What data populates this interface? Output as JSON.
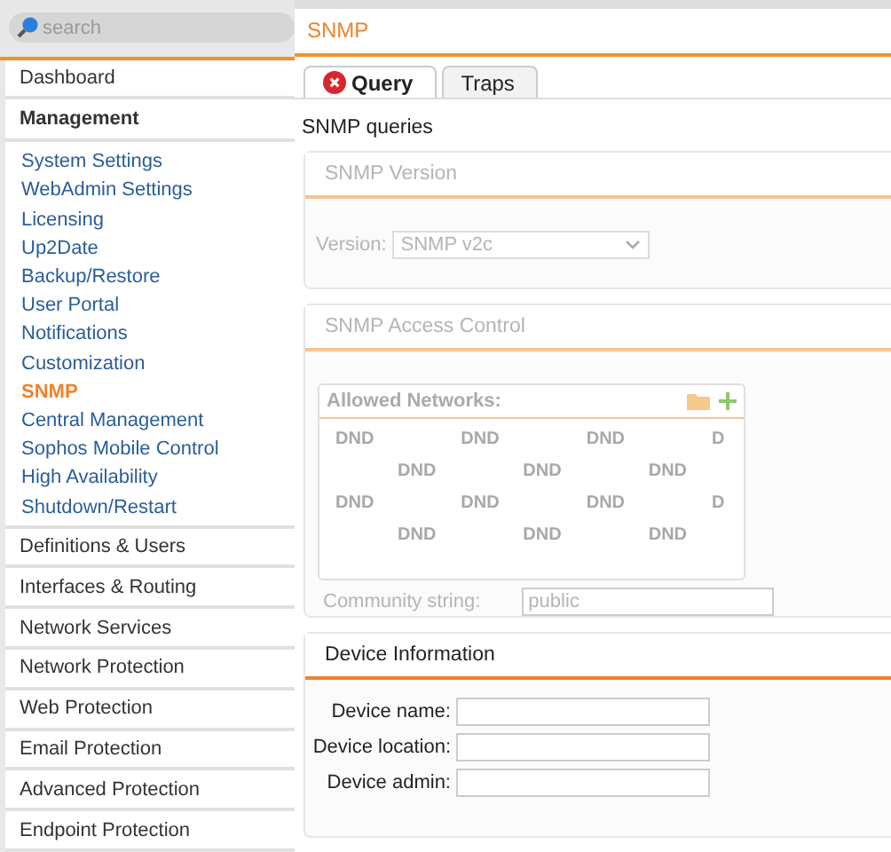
{
  "search": {
    "placeholder": "search"
  },
  "sidebar": {
    "items": [
      {
        "label": "Dashboard",
        "expanded": false
      },
      {
        "label": "Management",
        "expanded": true,
        "children": [
          {
            "label": "System Settings",
            "selected": false
          },
          {
            "label": "WebAdmin Settings",
            "selected": false
          },
          {
            "label": "Licensing",
            "selected": false
          },
          {
            "label": "Up2Date",
            "selected": false
          },
          {
            "label": "Backup/Restore",
            "selected": false
          },
          {
            "label": "User Portal",
            "selected": false
          },
          {
            "label": "Notifications",
            "selected": false
          },
          {
            "label": "Customization",
            "selected": false
          },
          {
            "label": "SNMP",
            "selected": true
          },
          {
            "label": "Central Management",
            "selected": false
          },
          {
            "label": "Sophos Mobile Control",
            "selected": false
          },
          {
            "label": "High Availability",
            "selected": false
          },
          {
            "label": "Shutdown/Restart",
            "selected": false
          }
        ]
      },
      {
        "label": "Definitions & Users",
        "expanded": false
      },
      {
        "label": "Interfaces & Routing",
        "expanded": false
      },
      {
        "label": "Network Services",
        "expanded": false
      },
      {
        "label": "Network Protection",
        "expanded": false
      },
      {
        "label": "Web Protection",
        "expanded": false
      },
      {
        "label": "Email Protection",
        "expanded": false
      },
      {
        "label": "Advanced Protection",
        "expanded": false
      },
      {
        "label": "Endpoint Protection",
        "expanded": false
      }
    ]
  },
  "page_title": "SNMP",
  "tabs": [
    {
      "label": "Query",
      "selected": true,
      "error": true
    },
    {
      "label": "Traps",
      "selected": false,
      "error": false
    }
  ],
  "section_title": "SNMP queries",
  "panels": [
    {
      "kind": "version",
      "title": "SNMP Version",
      "disabled": true,
      "label": "Version:",
      "value": "SNMP v2c"
    },
    {
      "kind": "access",
      "title": "SNMP Access Control",
      "disabled": true,
      "list_title": "Allowed Networks:",
      "dnd_rows": [
        [
          "DND",
          "DND",
          "DND",
          "D"
        ],
        [
          "DND",
          "DND",
          "DND"
        ],
        [
          "DND",
          "DND",
          "DND",
          "D"
        ],
        [
          "DND",
          "DND",
          "DND"
        ]
      ],
      "label": "Community string:",
      "value": "public"
    },
    {
      "kind": "form",
      "title": "Device Information",
      "disabled": false,
      "fields": [
        {
          "label": "Device name:"
        },
        {
          "label": "Device location:"
        },
        {
          "label": "Device admin:"
        }
      ]
    }
  ]
}
